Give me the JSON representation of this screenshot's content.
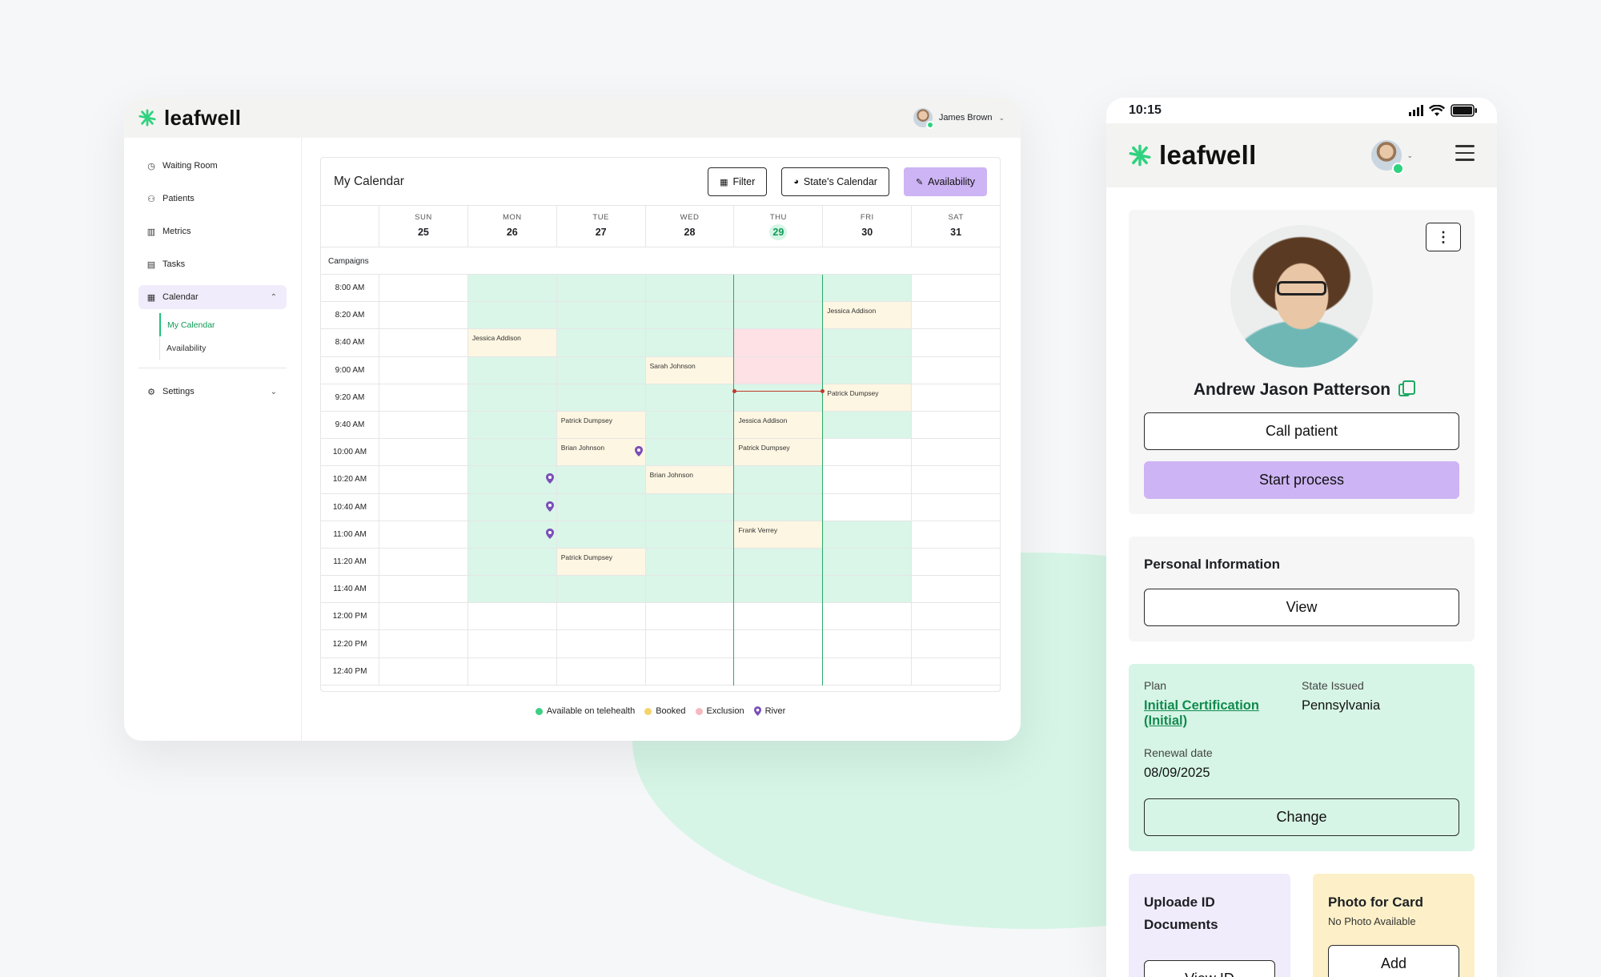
{
  "brand": {
    "name": "leafwell",
    "accent": "#2fd27f"
  },
  "desktop": {
    "user_name": "James Brown",
    "nav": {
      "items": [
        {
          "label": "Waiting Room",
          "icon": "clock-icon"
        },
        {
          "label": "Patients",
          "icon": "users-icon"
        },
        {
          "label": "Metrics",
          "icon": "bar-chart-icon"
        },
        {
          "label": "Tasks",
          "icon": "document-icon"
        },
        {
          "label": "Calendar",
          "icon": "calendar-icon"
        }
      ],
      "calendar_sub": [
        "My Calendar",
        "Availability"
      ],
      "settings": "Settings"
    },
    "calendar": {
      "title": "My Calendar",
      "filter_label": "Filter",
      "states_label": "State's Calendar",
      "availability_label": "Availability",
      "days": [
        {
          "name": "SUN",
          "num": "25"
        },
        {
          "name": "MON",
          "num": "26"
        },
        {
          "name": "TUE",
          "num": "27"
        },
        {
          "name": "WED",
          "num": "28"
        },
        {
          "name": "THU",
          "num": "29",
          "today": true
        },
        {
          "name": "FRI",
          "num": "30"
        },
        {
          "name": "SAT",
          "num": "31"
        }
      ],
      "campaigns_label": "Campaigns",
      "times": [
        "8:00 AM",
        "8:20 AM",
        "8:40 AM",
        "9:00 AM",
        "9:20 AM",
        "9:40 AM",
        "10:00 AM",
        "10:20 AM",
        "10:40 AM",
        "11:00 AM",
        "11:20 AM",
        "11:40 AM",
        "12:00 PM",
        "12:20 PM",
        "12:40 PM"
      ],
      "availability": {
        "1": [
          0,
          1,
          2,
          3,
          4,
          5,
          6,
          7,
          8,
          9,
          10,
          11
        ],
        "2": [
          0,
          1,
          2,
          3,
          4,
          5,
          6,
          7,
          8,
          9,
          10,
          11
        ],
        "3": [
          0,
          1,
          2,
          3,
          4,
          5,
          6,
          7,
          8,
          9,
          10,
          11
        ],
        "4": [
          0,
          1,
          2,
          3,
          4,
          5,
          6,
          7,
          8,
          9,
          10,
          11
        ],
        "5": [
          0,
          1,
          2,
          3,
          4,
          5,
          9,
          10,
          11
        ]
      },
      "exclusions": [
        {
          "day": 4,
          "rows": [
            2,
            3
          ]
        }
      ],
      "appointments": [
        {
          "day": 1,
          "row": 2,
          "name": "Jessica Addison"
        },
        {
          "day": 3,
          "row": 3,
          "name": "Sarah Johnson"
        },
        {
          "day": 2,
          "row": 5,
          "name": "Patrick Dumpsey"
        },
        {
          "day": 2,
          "row": 6,
          "name": "Brian Johnson"
        },
        {
          "day": 3,
          "row": 7,
          "name": "Brian Johnson"
        },
        {
          "day": 4,
          "row": 5,
          "name": "Jessica Addison"
        },
        {
          "day": 4,
          "row": 6,
          "name": "Patrick Dumpsey"
        },
        {
          "day": 4,
          "row": 9,
          "name": "Frank Verrey"
        },
        {
          "day": 5,
          "row": 1,
          "name": "Jessica Addison"
        },
        {
          "day": 5,
          "row": 4,
          "name": "Patrick Dumpsey"
        },
        {
          "day": 2,
          "row": 10,
          "name": "Patrick Dumpsey"
        }
      ],
      "river_pins": [
        {
          "day": 2,
          "row": 6
        },
        {
          "day": 1,
          "row": 7
        },
        {
          "day": 1,
          "row": 8
        },
        {
          "day": 1,
          "row": 9
        }
      ],
      "legend": [
        {
          "label": "Available on telehealth",
          "color": "#3ecf84",
          "shape": "dot"
        },
        {
          "label": "Booked",
          "color": "#f5d36b",
          "shape": "dot"
        },
        {
          "label": "Exclusion",
          "color": "#f7b9c0",
          "shape": "dot"
        },
        {
          "label": "River",
          "color": "#7b4fb8",
          "shape": "pin"
        }
      ]
    }
  },
  "mobile": {
    "time": "10:15",
    "patient_name": "Andrew Jason Patterson",
    "call_label": "Call patient",
    "start_label": "Start process",
    "personal_info_title": "Personal Information",
    "view_label": "View",
    "plan_key": "Plan",
    "plan_value": "Initial Certification (Initial)",
    "state_key": "State Issued",
    "state_value": "Pennsylvania",
    "renewal_key": "Renewal date",
    "renewal_value": "08/09/2025",
    "change_label": "Change",
    "upload_title": "Uploade ID Documents",
    "view_id_label": "View ID",
    "photo_title": "Photo for Card",
    "photo_sub": "No Photo Available",
    "add_label": "Add"
  }
}
